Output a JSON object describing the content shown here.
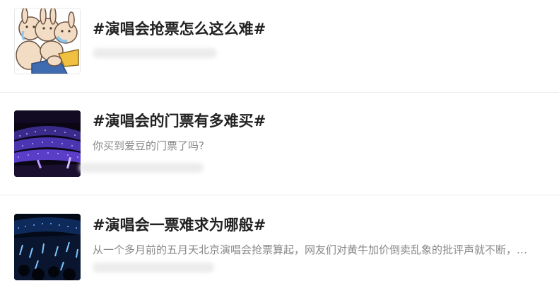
{
  "topics": [
    {
      "title": "#演唱会抢票怎么这么难#",
      "summary": "",
      "thumbnail_icon": "cartoon-rabbits-thumbnail"
    },
    {
      "title": "#演唱会的门票有多难买#",
      "summary": "你买到爱豆的门票了吗?",
      "thumbnail_icon": "concert-stadium-purple-thumbnail"
    },
    {
      "title": "#演唱会一票难求为哪般#",
      "summary": "从一个多月前的五月天北京演唱会抢票算起，网友们对黄牛加价倒卖乱象的批评声就不断，…",
      "thumbnail_icon": "concert-crowd-blue-thumbnail"
    }
  ],
  "colors": {
    "title": "#222222",
    "summary": "#888888",
    "divider": "#ececec",
    "background": "#ffffff"
  }
}
